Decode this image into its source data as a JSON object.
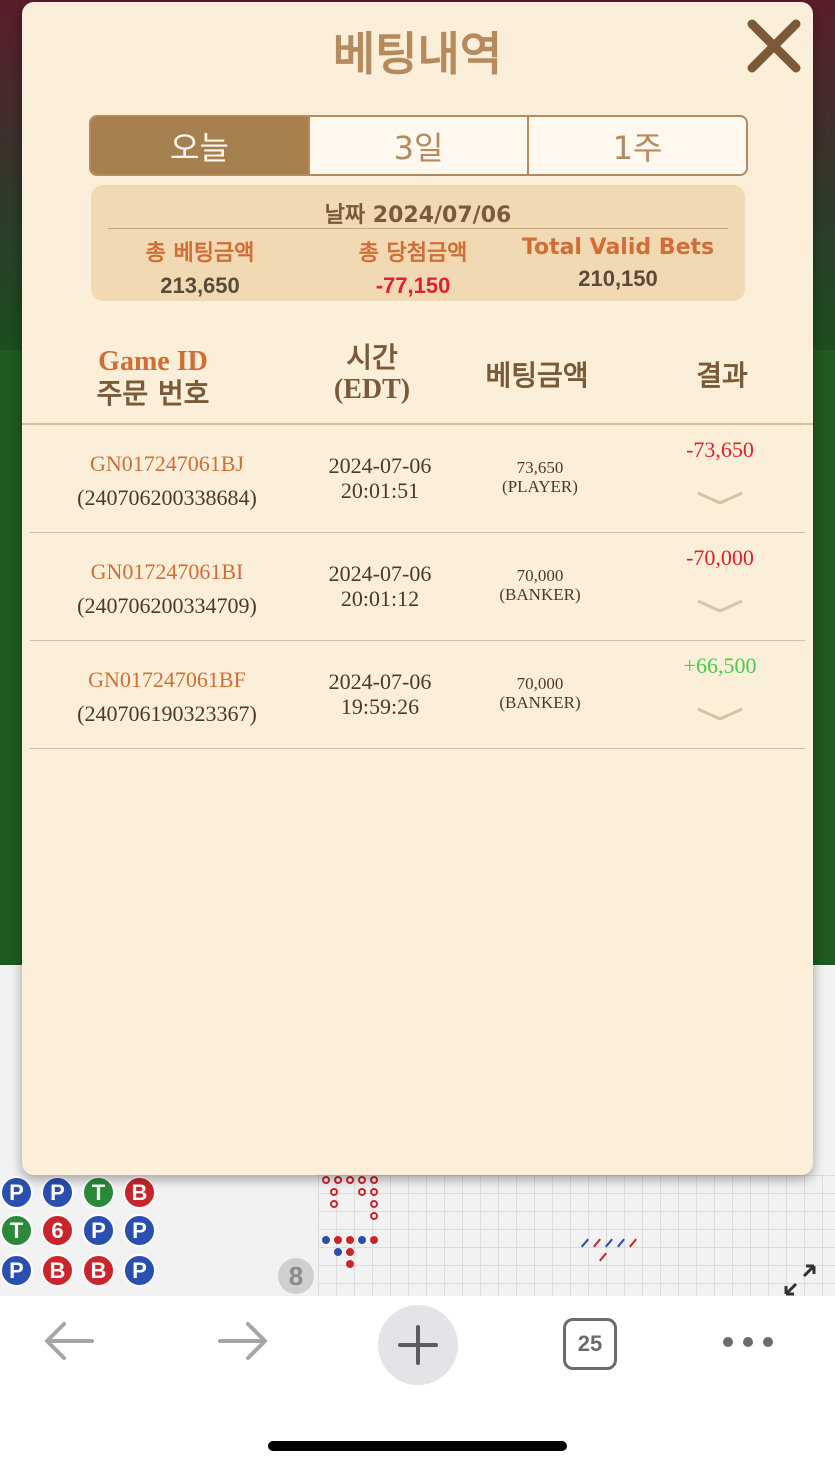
{
  "modal": {
    "title": "베팅내역",
    "tabs": [
      {
        "label": "오늘",
        "active": true
      },
      {
        "label": "3일",
        "active": false
      },
      {
        "label": "1주",
        "active": false
      }
    ],
    "summary": {
      "date_label": "날짜 2024/07/06",
      "total_bet_label": "총 베팅금액",
      "total_bet_value": "213,650",
      "total_win_label": "총 당첨금액",
      "total_win_value": "-77,150",
      "valid_bets_label": "Total Valid Bets",
      "valid_bets_value": "210,150"
    },
    "table": {
      "headers": {
        "game_id": "Game ID",
        "order_no": "주문 번호",
        "time": "시간",
        "timezone": "(EDT)",
        "bet_amount": "베팅금액",
        "result": "결과"
      },
      "rows": [
        {
          "game_id": "GN017247061BJ",
          "order_no": "(240706200338684)",
          "date": "2024-07-06",
          "time": "20:01:51",
          "bet": "73,650",
          "side": "(PLAYER)",
          "result": "-73,650",
          "positive": false
        },
        {
          "game_id": "GN017247061BI",
          "order_no": "(240706200334709)",
          "date": "2024-07-06",
          "time": "20:01:12",
          "bet": "70,000",
          "side": "(BANKER)",
          "result": "-70,000",
          "positive": false
        },
        {
          "game_id": "GN017247061BF",
          "order_no": "(240706190323367)",
          "date": "2024-07-06",
          "time": "19:59:26",
          "bet": "70,000",
          "side": "(BANKER)",
          "result": "+66,500",
          "positive": true
        }
      ]
    }
  },
  "background": {
    "bead_road": [
      [
        "P",
        "P",
        "T",
        "B"
      ],
      [
        "T",
        "6",
        "P",
        "P"
      ],
      [
        "P",
        "B",
        "B",
        "P"
      ]
    ],
    "counter_icon": "8"
  },
  "toolbar": {
    "tab_count": "25",
    "icons": [
      "back-arrow-icon",
      "forward-arrow-icon",
      "plus-icon",
      "tabs-icon",
      "more-icon"
    ]
  },
  "colors": {
    "modal_bg": "#fcefd9",
    "accent": "#a7804f",
    "orange": "#d16e36",
    "negative": "#e0202a",
    "positive": "#4ac94a"
  }
}
